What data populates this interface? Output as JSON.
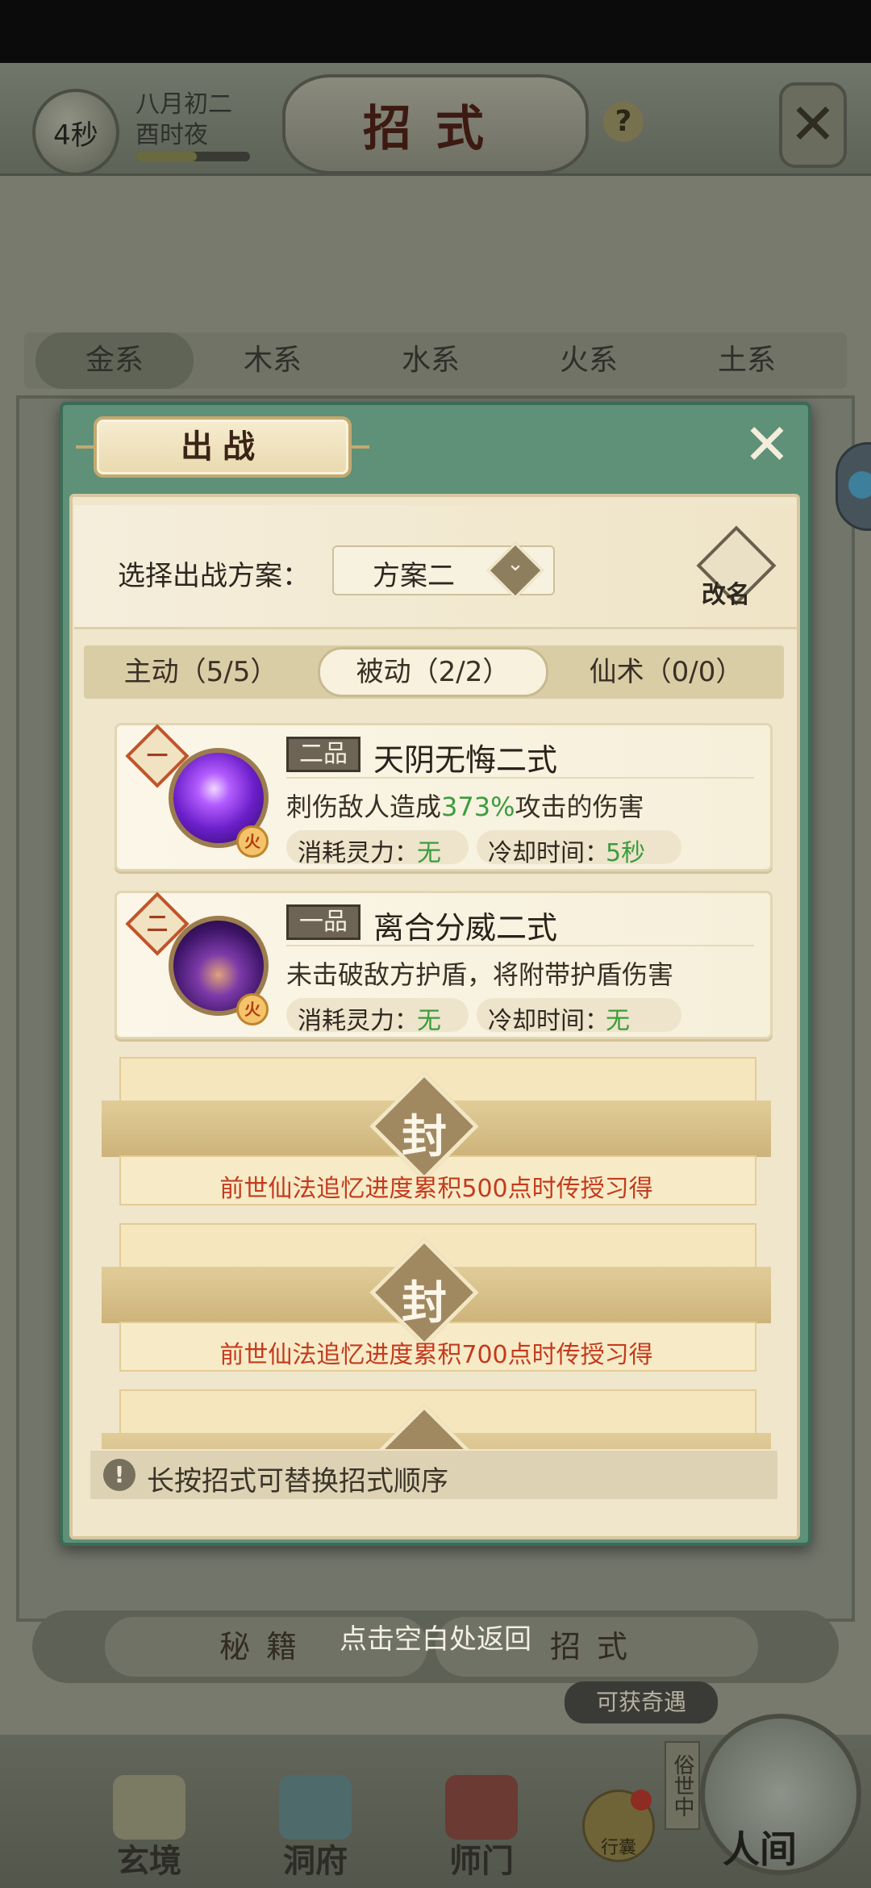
{
  "header": {
    "timer": "4秒",
    "date_line1": "八月初二",
    "date_line2": "酉时夜",
    "title": "招式",
    "help": "?",
    "close_glyph": "✕"
  },
  "element_tabs": [
    "金系",
    "木系",
    "水系",
    "火系",
    "土系"
  ],
  "bottom_buttons": {
    "left": "秘籍",
    "right": "招式"
  },
  "adventure_tag": "可获奇遇",
  "nav": {
    "items": [
      {
        "label": "玄境"
      },
      {
        "label": "洞府"
      },
      {
        "label": "师门"
      }
    ],
    "bag_label": "行囊",
    "world_vertical": "俗世中",
    "world_label": "人间"
  },
  "tap_return": "点击空白处返回",
  "dialog": {
    "title": "出战",
    "close_glyph": "✕",
    "plan_label": "选择出战方案：",
    "plan_value": "方案二",
    "plan_chevron": "⌄",
    "rename_label": "改名",
    "subtabs": [
      "主动（5/5）",
      "被动（2/2）",
      "仙术（0/0）"
    ],
    "active_subtab": 1,
    "skills": [
      {
        "rank": "一",
        "element": "火",
        "grade": "二品",
        "name": "天阴无悔二式",
        "desc_prefix": "刺伤敌人造成",
        "desc_highlight": "373%",
        "desc_suffix": "攻击的伤害",
        "cost_label": "消耗灵力：",
        "cost_value": "无",
        "cooldown_label": "冷却时间：",
        "cooldown_value": "5秒"
      },
      {
        "rank": "二",
        "element": "火",
        "grade": "一品",
        "name": "离合分威二式",
        "desc_prefix": "未击破敌方护盾，将附带护盾伤害",
        "desc_highlight": "",
        "desc_suffix": "",
        "cost_label": "消耗灵力：",
        "cost_value": "无",
        "cooldown_label": "冷却时间：",
        "cooldown_value": "无"
      }
    ],
    "locked_slots": [
      {
        "seal": "封",
        "text": "前世仙法追忆进度累积500点时传授习得"
      },
      {
        "seal": "封",
        "text": "前世仙法追忆进度累积700点时传授习得"
      }
    ],
    "tip_icon": "!",
    "tip": "长按招式可替换招式顺序"
  },
  "colors": {
    "accent_green": "#3c9c3e",
    "lock_red": "#c43a1d",
    "dialog_frame": "#5f9078",
    "parchment": "#efe6cc"
  }
}
